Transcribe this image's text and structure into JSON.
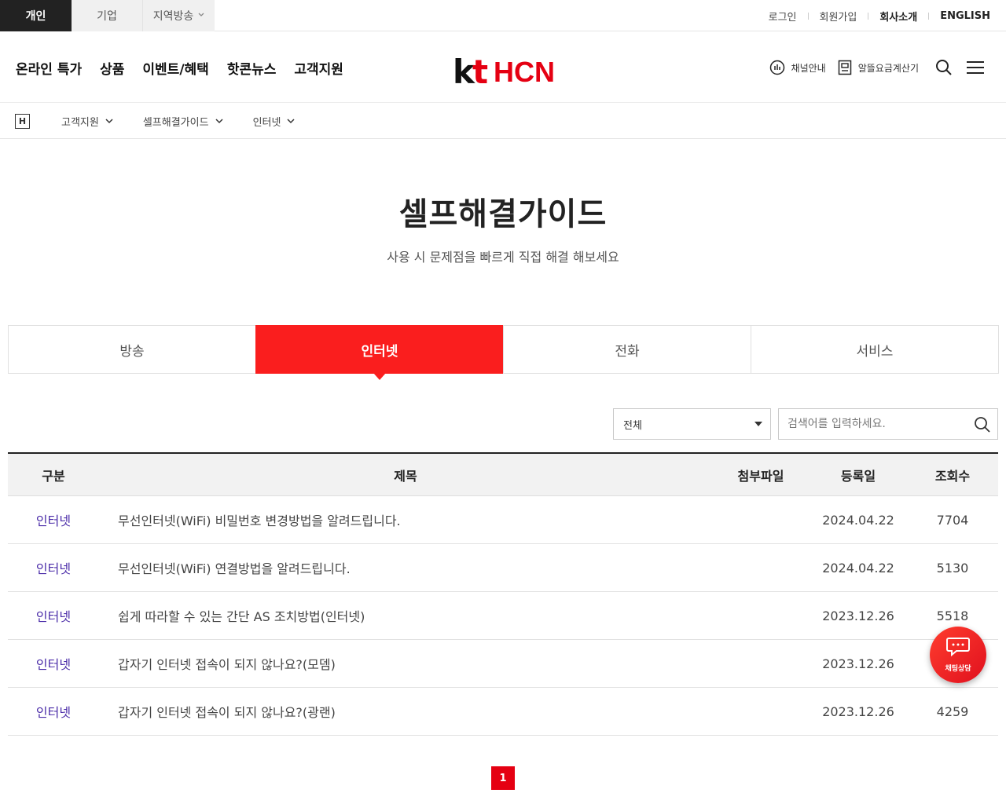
{
  "topbar": {
    "segments": [
      "개인",
      "기업",
      "지역방송"
    ],
    "util": [
      "로그인",
      "회원가입",
      "회사소개",
      "ENGLISH"
    ]
  },
  "gnb": {
    "menu": [
      "온라인 특가",
      "상품",
      "이벤트/혜택",
      "핫콘뉴스",
      "고객지원"
    ],
    "logo_kt": "kt",
    "logo_hcn": "HCN",
    "channel_label": "채널안내",
    "calc_label": "알뜰요금계산기"
  },
  "breadcrumb": {
    "home_label": "H",
    "items": [
      "고객지원",
      "셀프해결가이드",
      "인터넷"
    ]
  },
  "hero": {
    "title": "셀프해결가이드",
    "subtitle": "사용 시 문제점을 빠르게 직접 해결 해보세요"
  },
  "tabs": [
    "방송",
    "인터넷",
    "전화",
    "서비스"
  ],
  "filter": {
    "select_value": "전체",
    "search_placeholder": "검색어를 입력하세요."
  },
  "table": {
    "headers": [
      "구분",
      "제목",
      "첨부파일",
      "등록일",
      "조회수"
    ],
    "rows": [
      {
        "category": "인터넷",
        "title": "무선인터넷(WiFi) 비밀번호 변경방법을 알려드립니다.",
        "date": "2024.04.22",
        "views": "7704"
      },
      {
        "category": "인터넷",
        "title": "무선인터넷(WiFi) 연결방법을 알려드립니다.",
        "date": "2024.04.22",
        "views": "5130"
      },
      {
        "category": "인터넷",
        "title": "쉽게 따라할 수 있는 간단 AS 조치방법(인터넷)",
        "date": "2023.12.26",
        "views": "5518"
      },
      {
        "category": "인터넷",
        "title": "갑자기 인터넷 접속이 되지 않나요?(모뎀)",
        "date": "2023.12.26",
        "views": ""
      },
      {
        "category": "인터넷",
        "title": "갑자기 인터넷 접속이 되지 않나요?(광랜)",
        "date": "2023.12.26",
        "views": "4259"
      }
    ]
  },
  "pager": {
    "current": "1"
  },
  "chat": {
    "label": "채팅상담"
  },
  "colors": {
    "accent": "#fa1e1e",
    "brand_red": "#e50012",
    "category_text": "#4a2ba8"
  }
}
